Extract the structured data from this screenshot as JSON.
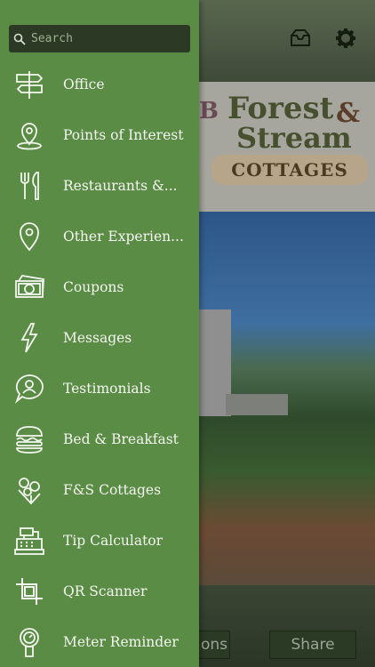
{
  "search": {
    "placeholder": "Search"
  },
  "menu": {
    "items": [
      {
        "label": "Office",
        "icon": "signpost-icon"
      },
      {
        "label": "Points of Interest",
        "icon": "map-pin-icon"
      },
      {
        "label": "Restaurants &...",
        "icon": "fork-knife-icon"
      },
      {
        "label": "Other Experien...",
        "icon": "map-pin-icon"
      },
      {
        "label": "Coupons",
        "icon": "money-icon"
      },
      {
        "label": "Messages",
        "icon": "lightning-icon"
      },
      {
        "label": "Testimonials",
        "icon": "speech-bubble-icon"
      },
      {
        "label": "Bed & Breakfast",
        "icon": "burger-icon"
      },
      {
        "label": "F&S Cottages",
        "icon": "flowers-icon"
      },
      {
        "label": "Tip Calculator",
        "icon": "cash-register-icon"
      },
      {
        "label": "QR Scanner",
        "icon": "crop-icon"
      },
      {
        "label": "Meter Reminder",
        "icon": "parking-meter-icon"
      }
    ]
  },
  "background": {
    "logo": {
      "line1": "Forest",
      "amp": "&",
      "line2": "Stream",
      "line3": "COTTAGES",
      "mark": "B"
    },
    "buttons": {
      "left_label": "ons",
      "share_label": "Share"
    }
  },
  "colors": {
    "drawer": "#5a8c45",
    "search_bg": "#2c3a25"
  }
}
